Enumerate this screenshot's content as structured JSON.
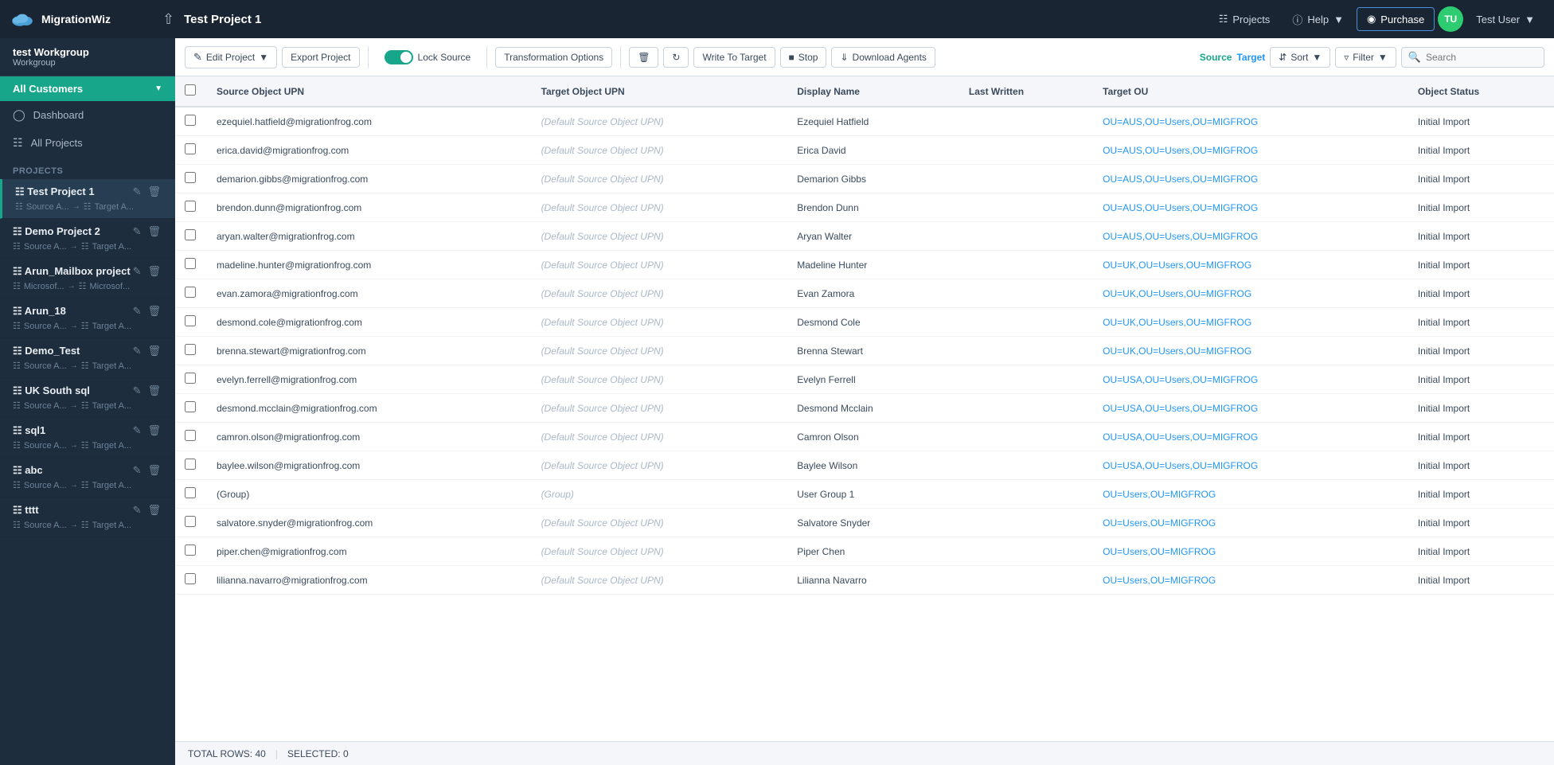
{
  "topNav": {
    "appName": "MigrationWiz",
    "projectTitle": "Test Project 1",
    "projectsLabel": "Projects",
    "helpLabel": "Help",
    "purchaseLabel": "Purchase",
    "userInitials": "TU",
    "userName": "Test User"
  },
  "sidebar": {
    "workgroupName": "test Workgroup",
    "workgroupSub": "Workgroup",
    "allCustomersLabel": "All Customers",
    "dashboardLabel": "Dashboard",
    "allProjectsLabel": "All Projects",
    "projectsSectionLabel": "PROJECTS",
    "projects": [
      {
        "name": "Test Project 1",
        "active": true,
        "sourceLabel": "Source A...",
        "targetLabel": "Target A..."
      },
      {
        "name": "Demo Project 2",
        "active": false,
        "sourceLabel": "Source A...",
        "targetLabel": "Target A..."
      },
      {
        "name": "Arun_Mailbox project",
        "active": false,
        "sourceLabel": "Microsof...",
        "targetLabel": "Microsof..."
      },
      {
        "name": "Arun_18",
        "active": false,
        "sourceLabel": "Source A...",
        "targetLabel": "Target A..."
      },
      {
        "name": "Demo_Test",
        "active": false,
        "sourceLabel": "Source A...",
        "targetLabel": "Target A..."
      },
      {
        "name": "UK South sql",
        "active": false,
        "sourceLabel": "Source A...",
        "targetLabel": "Target A..."
      },
      {
        "name": "sql1",
        "active": false,
        "sourceLabel": "Source A...",
        "targetLabel": "Target A..."
      },
      {
        "name": "abc",
        "active": false,
        "sourceLabel": "Source A...",
        "targetLabel": "Target A..."
      },
      {
        "name": "tttt",
        "active": false,
        "sourceLabel": "Source A...",
        "targetLabel": "Target A..."
      }
    ]
  },
  "toolbar": {
    "editProjectLabel": "Edit Project",
    "exportProjectLabel": "Export Project",
    "lockSourceLabel": "Lock Source",
    "transformationOptionsLabel": "Transformation Options",
    "writeToTargetLabel": "Write To Target",
    "stopLabel": "Stop",
    "downloadAgentsLabel": "Download Agents",
    "sourceLabel": "Source",
    "targetLabel": "Target",
    "sortLabel": "Sort",
    "filterLabel": "Filter",
    "searchPlaceholder": "Search"
  },
  "table": {
    "columns": [
      "Source Object UPN",
      "Target Object UPN",
      "Display Name",
      "Last Written",
      "Target OU",
      "Object Status"
    ],
    "rows": [
      {
        "sourceUPN": "ezequiel.hatfield@migrationfrog.com",
        "targetUPN": "(Default Source Object UPN)",
        "displayName": "Ezequiel Hatfield",
        "lastWritten": "",
        "targetOU": "OU=AUS,OU=Users,OU=MIGFROG",
        "status": "Initial Import"
      },
      {
        "sourceUPN": "erica.david@migrationfrog.com",
        "targetUPN": "(Default Source Object UPN)",
        "displayName": "Erica David",
        "lastWritten": "",
        "targetOU": "OU=AUS,OU=Users,OU=MIGFROG",
        "status": "Initial Import"
      },
      {
        "sourceUPN": "demarion.gibbs@migrationfrog.com",
        "targetUPN": "(Default Source Object UPN)",
        "displayName": "Demarion Gibbs",
        "lastWritten": "",
        "targetOU": "OU=AUS,OU=Users,OU=MIGFROG",
        "status": "Initial Import"
      },
      {
        "sourceUPN": "brendon.dunn@migrationfrog.com",
        "targetUPN": "(Default Source Object UPN)",
        "displayName": "Brendon Dunn",
        "lastWritten": "",
        "targetOU": "OU=AUS,OU=Users,OU=MIGFROG",
        "status": "Initial Import"
      },
      {
        "sourceUPN": "aryan.walter@migrationfrog.com",
        "targetUPN": "(Default Source Object UPN)",
        "displayName": "Aryan Walter",
        "lastWritten": "",
        "targetOU": "OU=AUS,OU=Users,OU=MIGFROG",
        "status": "Initial Import"
      },
      {
        "sourceUPN": "madeline.hunter@migrationfrog.com",
        "targetUPN": "(Default Source Object UPN)",
        "displayName": "Madeline Hunter",
        "lastWritten": "",
        "targetOU": "OU=UK,OU=Users,OU=MIGFROG",
        "status": "Initial Import"
      },
      {
        "sourceUPN": "evan.zamora@migrationfrog.com",
        "targetUPN": "(Default Source Object UPN)",
        "displayName": "Evan Zamora",
        "lastWritten": "",
        "targetOU": "OU=UK,OU=Users,OU=MIGFROG",
        "status": "Initial Import"
      },
      {
        "sourceUPN": "desmond.cole@migrationfrog.com",
        "targetUPN": "(Default Source Object UPN)",
        "displayName": "Desmond Cole",
        "lastWritten": "",
        "targetOU": "OU=UK,OU=Users,OU=MIGFROG",
        "status": "Initial Import"
      },
      {
        "sourceUPN": "brenna.stewart@migrationfrog.com",
        "targetUPN": "(Default Source Object UPN)",
        "displayName": "Brenna Stewart",
        "lastWritten": "",
        "targetOU": "OU=UK,OU=Users,OU=MIGFROG",
        "status": "Initial Import"
      },
      {
        "sourceUPN": "evelyn.ferrell@migrationfrog.com",
        "targetUPN": "(Default Source Object UPN)",
        "displayName": "Evelyn Ferrell",
        "lastWritten": "",
        "targetOU": "OU=USA,OU=Users,OU=MIGFROG",
        "status": "Initial Import"
      },
      {
        "sourceUPN": "desmond.mcclain@migrationfrog.com",
        "targetUPN": "(Default Source Object UPN)",
        "displayName": "Desmond Mcclain",
        "lastWritten": "",
        "targetOU": "OU=USA,OU=Users,OU=MIGFROG",
        "status": "Initial Import"
      },
      {
        "sourceUPN": "camron.olson@migrationfrog.com",
        "targetUPN": "(Default Source Object UPN)",
        "displayName": "Camron Olson",
        "lastWritten": "",
        "targetOU": "OU=USA,OU=Users,OU=MIGFROG",
        "status": "Initial Import"
      },
      {
        "sourceUPN": "baylee.wilson@migrationfrog.com",
        "targetUPN": "(Default Source Object UPN)",
        "displayName": "Baylee Wilson",
        "lastWritten": "",
        "targetOU": "OU=USA,OU=Users,OU=MIGFROG",
        "status": "Initial Import"
      },
      {
        "sourceUPN": "(Group)",
        "targetUPN": "(Group)",
        "displayName": "User Group 1",
        "lastWritten": "",
        "targetOU": "OU=Users,OU=MIGFROG",
        "status": "Initial Import"
      },
      {
        "sourceUPN": "salvatore.snyder@migrationfrog.com",
        "targetUPN": "(Default Source Object UPN)",
        "displayName": "Salvatore Snyder",
        "lastWritten": "",
        "targetOU": "OU=Users,OU=MIGFROG",
        "status": "Initial Import"
      },
      {
        "sourceUPN": "piper.chen@migrationfrog.com",
        "targetUPN": "(Default Source Object UPN)",
        "displayName": "Piper Chen",
        "lastWritten": "",
        "targetOU": "OU=Users,OU=MIGFROG",
        "status": "Initial Import"
      },
      {
        "sourceUPN": "lilianna.navarro@migrationfrog.com",
        "targetUPN": "(Default Source Object UPN)",
        "displayName": "Lilianna Navarro",
        "lastWritten": "",
        "targetOU": "OU=Users,OU=MIGFROG",
        "status": "Initial Import"
      }
    ]
  },
  "statusBar": {
    "totalRows": "TOTAL ROWS: 40",
    "selected": "SELECTED: 0"
  },
  "colors": {
    "teal": "#17a689",
    "blue": "#2196F3",
    "dark": "#1a2533",
    "sidebar": "#1e2d3d"
  }
}
